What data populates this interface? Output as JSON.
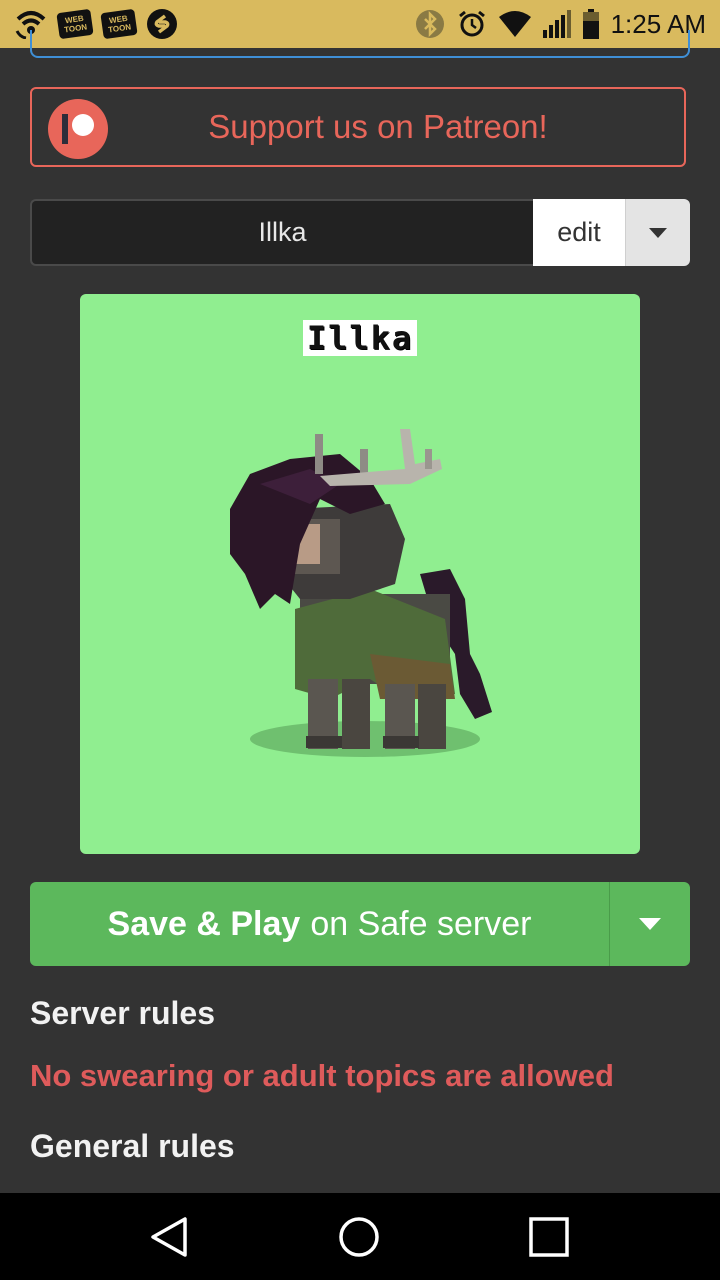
{
  "status_bar": {
    "time": "1:25 AM",
    "icons": [
      "wifi-calling-icon",
      "webtoon-icon",
      "webtoon-icon",
      "shazam-icon",
      "bluetooth-icon",
      "alarm-icon",
      "wifi-icon",
      "signal-icon",
      "battery-icon"
    ],
    "webtoon_line1": "WEB",
    "webtoon_line2": "TOON"
  },
  "patreon": {
    "label": "Support us on Patreon!",
    "color": "#e8665a"
  },
  "character": {
    "name": "Illka",
    "edit_label": "edit"
  },
  "preview": {
    "name_tag": "Illka",
    "background": "#90ee90"
  },
  "save": {
    "bold_label": "Save & Play",
    "rest_label": "on Safe server",
    "color": "#5cb85c"
  },
  "rules": {
    "server_title": "Server rules",
    "server_warning": "No swearing or adult topics are allowed",
    "general_title": "General rules"
  },
  "nav": {
    "icons": [
      "back-icon",
      "home-icon",
      "recents-icon"
    ]
  }
}
